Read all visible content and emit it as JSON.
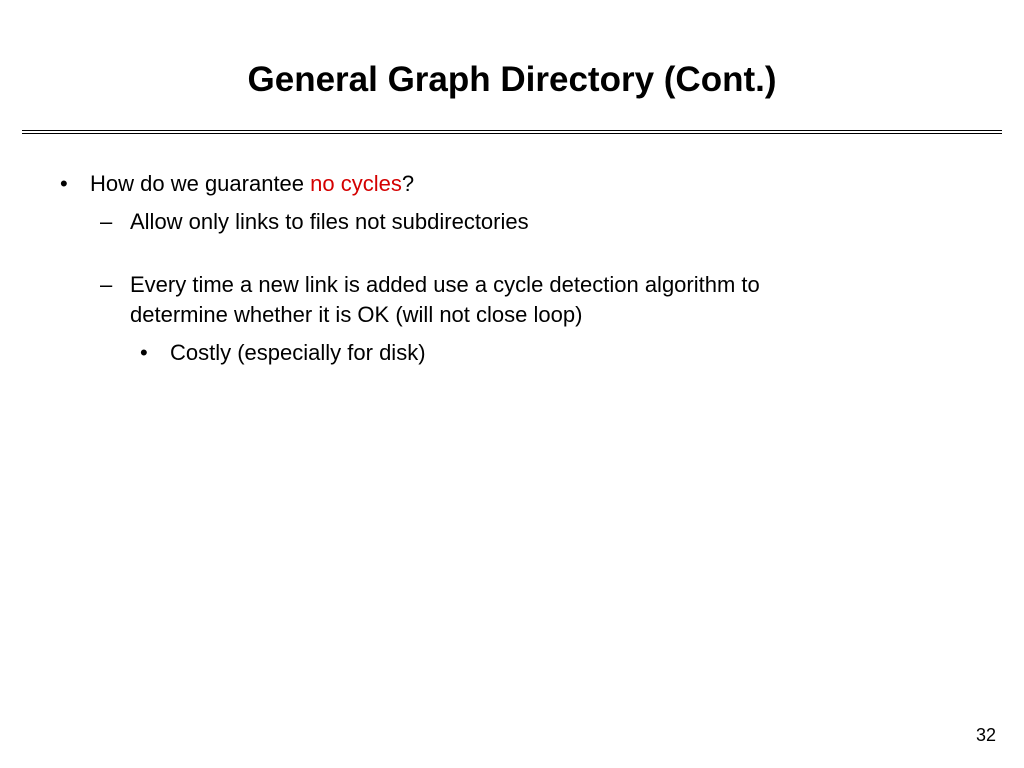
{
  "title": "General Graph Directory (Cont.)",
  "level1": {
    "prefix": "How do we guarantee ",
    "highlight": "no cycles",
    "suffix": "?"
  },
  "level2_a": "Allow only links to files not subdirectories",
  "level2_b": "Every time a new link is added use a cycle detection algorithm to determine whether it is OK (will not close loop)",
  "level3": "Costly (especially for disk)",
  "page_number": "32"
}
